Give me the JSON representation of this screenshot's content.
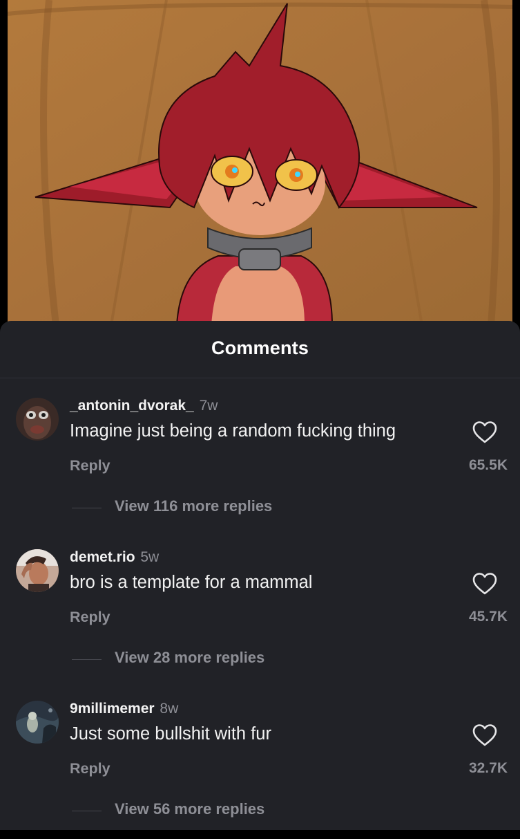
{
  "post": {
    "image_description_icon": "cartoon-character-artwork"
  },
  "sheet": {
    "title": "Comments"
  },
  "comments": [
    {
      "username": "_antonin_dvorak_",
      "age": "7w",
      "text": "Imagine just being a random fucking thing",
      "reply_label": "Reply",
      "likes": "65.5K",
      "view_replies": "View 116 more replies",
      "avatar_icon": "user-avatar"
    },
    {
      "username": "demet.rio",
      "age": "5w",
      "text": "bro is a template for a mammal",
      "reply_label": "Reply",
      "likes": "45.7K",
      "view_replies": "View 28 more replies",
      "avatar_icon": "user-avatar"
    },
    {
      "username": "9millimemer",
      "age": "8w",
      "text": "Just some bullshit with fur",
      "reply_label": "Reply",
      "likes": "32.7K",
      "view_replies": "View 56 more replies",
      "avatar_icon": "user-avatar"
    }
  ],
  "colors": {
    "sheet_background": "#212227",
    "secondary_text": "#8e8f96",
    "primary_text": "#f2f2f2"
  }
}
